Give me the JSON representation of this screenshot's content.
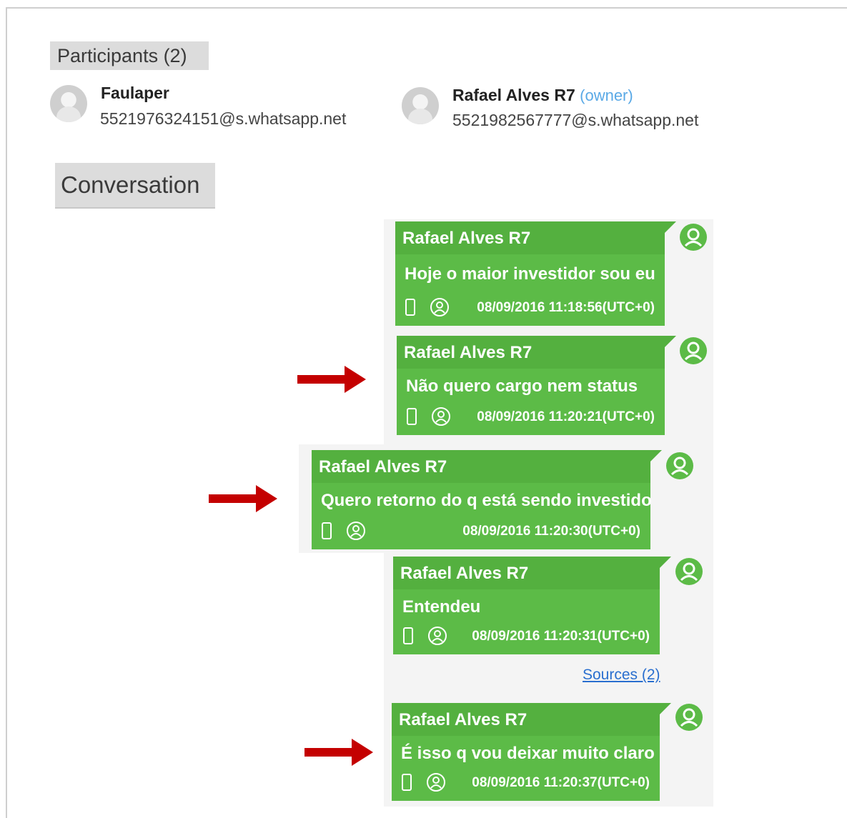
{
  "participants": {
    "title": "Participants (2)",
    "list": [
      {
        "name": "Faulaper",
        "role": "",
        "id": "5521976324151@s.whatsapp.net"
      },
      {
        "name": "Rafael Alves R7",
        "role": "(owner)",
        "id": "5521982567777@s.whatsapp.net"
      }
    ]
  },
  "conversation": {
    "title": "Conversation",
    "messages": [
      {
        "sender": "Rafael Alves R7",
        "text": "Hoje o maior investidor sou eu",
        "timestamp": "08/09/2016 11:18:56(UTC+0)"
      },
      {
        "sender": "Rafael Alves R7",
        "text": "Não quero cargo nem status",
        "timestamp": "08/09/2016 11:20:21(UTC+0)"
      },
      {
        "sender": "Rafael Alves R7",
        "text": "Quero retorno do q está sendo investido",
        "timestamp": "08/09/2016 11:20:30(UTC+0)"
      },
      {
        "sender": "Rafael Alves R7",
        "text": "Entendeu",
        "timestamp": "08/09/2016 11:20:31(UTC+0)"
      },
      {
        "sender": "Rafael Alves R7",
        "text": "É isso q vou deixar muito claro",
        "timestamp": "08/09/2016 11:20:37(UTC+0)"
      }
    ],
    "sources_link": "Sources (2)"
  },
  "icons": {
    "avatar": "default-avatar-icon",
    "phone": "phone-icon",
    "group": "group-icon",
    "user": "user-circle-icon",
    "arrow": "right-arrow-icon"
  },
  "colors": {
    "bubble": "#5cbb47",
    "bubble_header": "#54b03f",
    "arrow": "#c40000",
    "link": "#2a6fcf",
    "owner": "#5aa9e6"
  }
}
